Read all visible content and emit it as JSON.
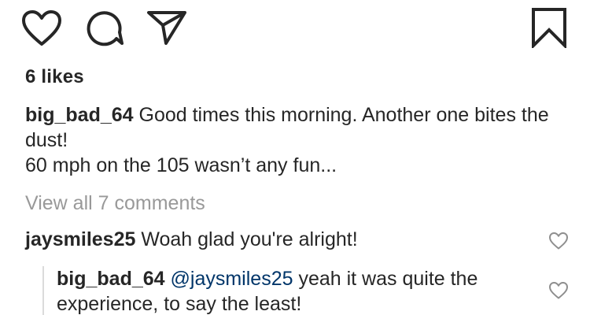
{
  "actions": {
    "like_icon": "heart-outline",
    "comment_icon": "speech-bubble",
    "share_icon": "paper-plane",
    "save_icon": "bookmark"
  },
  "likes": {
    "count_text": "6 likes"
  },
  "caption": {
    "username": "big_bad_64",
    "text_line1": " Good times this morning. Another one bites the dust!",
    "text_line2": "60 mph on the 105 wasn’t any fun..."
  },
  "view_all": {
    "label": "View all 7 comments"
  },
  "comments": [
    {
      "username": "jaysmiles25",
      "text": " Woah glad you're alright!"
    },
    {
      "username": "big_bad_64",
      "mention": "@jaysmiles25",
      "text": " yeah it was quite the experience, to say the least!"
    }
  ],
  "colors": {
    "text": "#262626",
    "muted": "#999999",
    "mention": "#003569",
    "divider": "#dbdbdb"
  }
}
